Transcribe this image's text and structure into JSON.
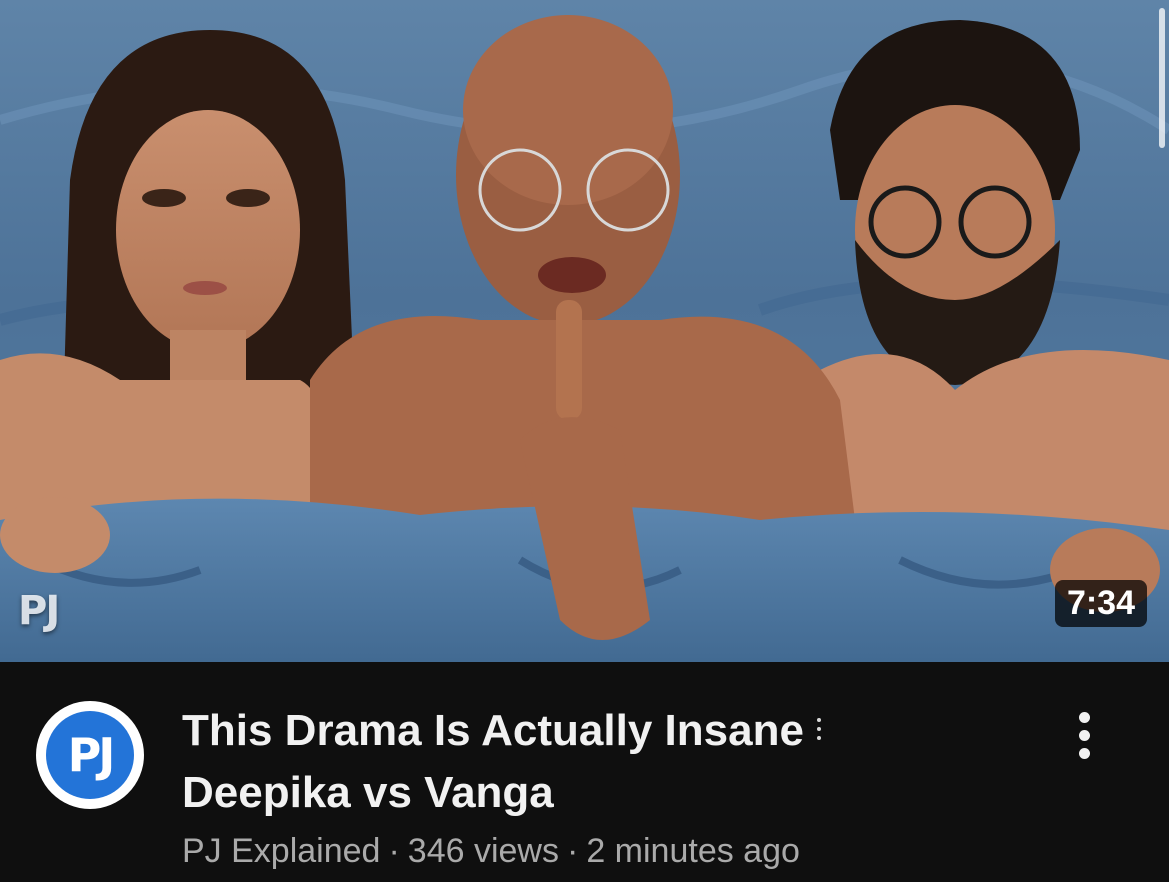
{
  "video": {
    "title_line1": "This Drama Is Actually Insane",
    "title_line2": "Deepika vs Vanga",
    "duration": "7:34",
    "thumbnail_watermark": "PJ"
  },
  "channel": {
    "name": "PJ Explained",
    "avatar_text": "PJ",
    "avatar_color": "#2374d8"
  },
  "stats": {
    "views": "346 views",
    "uploaded": "2 minutes ago",
    "separator": "·"
  },
  "icons": {
    "title_more": "vertical-ellipsis-icon",
    "menu": "vertical-ellipsis-icon"
  }
}
